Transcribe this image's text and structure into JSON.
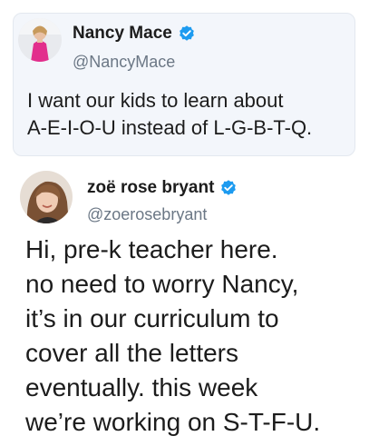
{
  "quoted_tweet": {
    "display_name": "Nancy Mace",
    "handle": "@NancyMace",
    "verified": true,
    "avatar": "avatar-woman-pink-dress",
    "text": "I want our kids to learn about\nA-E-I-O-U instead of L-G-B-T-Q."
  },
  "reply_tweet": {
    "display_name": "zoë rose bryant",
    "handle": "@zoerosebryant",
    "verified": true,
    "avatar": "avatar-smiling-woman",
    "text": "Hi, pre-k teacher here.\nno need to worry Nancy,\nit’s in our curriculum to\ncover all the letters\neventually. this week\nwe’re working on S-T-F-U."
  },
  "colors": {
    "verified_blue": "#1d9bf0",
    "card_background": "#f3f6fb",
    "handle_gray": "#6b7785",
    "text": "#1c1c1c"
  }
}
